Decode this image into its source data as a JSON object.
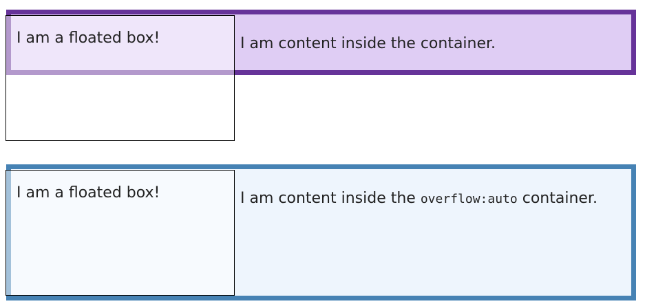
{
  "example1": {
    "float_text": "I am a floated box!",
    "content_text": "I am content inside the container."
  },
  "example2": {
    "float_text": "I am a floated box!",
    "content_prefix": "I am content inside the ",
    "content_code": "overflow:auto",
    "content_suffix": " container."
  },
  "colors": {
    "container1_border": "#663399",
    "container1_bg": "#dfcdf4",
    "container2_border": "#4682b4",
    "container2_bg": "#eef5fd"
  }
}
